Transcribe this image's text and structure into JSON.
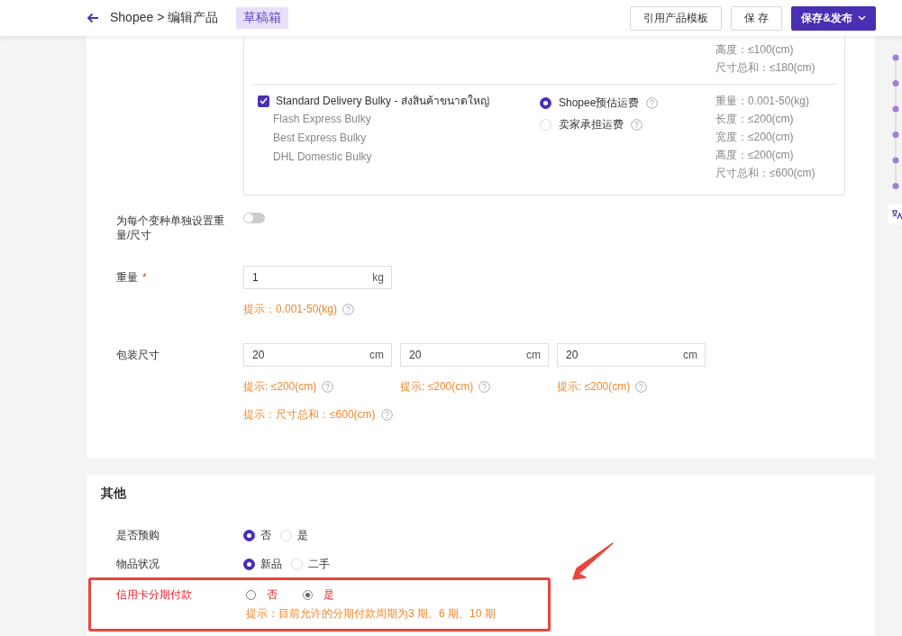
{
  "header": {
    "breadcrumb": "Shopee > 编辑产品",
    "badge": "草稿箱",
    "buttons": [
      {
        "label": "引用产品模板",
        "kind": "default"
      },
      {
        "label": "保 存",
        "kind": "default"
      },
      {
        "label": "保存&发布",
        "kind": "primary"
      }
    ]
  },
  "shipping": {
    "top_specs": [
      "高度：≤100(cm)",
      "尺寸总和：≤180(cm)"
    ],
    "channel": {
      "checked": true,
      "name": "Standard Delivery Bulky - ส่งสินค้าขนาดใหญ่",
      "carriers": [
        "Flash Express Bulky",
        "Best Express Bulky",
        "DHL Domestic Bulky"
      ],
      "fee_options": [
        {
          "label": "Shopee预估运费",
          "selected": true
        },
        {
          "label": "卖家承担运费",
          "selected": false
        }
      ],
      "specs": [
        "重量：0.001-50(kg)",
        "长度：≤200(cm)",
        "宽度：≤200(cm)",
        "高度：≤200(cm)",
        "尺寸总和：≤600(cm)"
      ]
    }
  },
  "variant_toggle": {
    "label": "为每个变种单独设置重量/尺寸",
    "on": false
  },
  "weight": {
    "label": "重量",
    "required_mark": "*",
    "value": "1",
    "unit": "kg",
    "hint": "提示：0.001-50(kg)"
  },
  "package": {
    "label": "包装尺寸",
    "fields": [
      {
        "value": "20",
        "unit": "cm",
        "hint": "提示: ≤200(cm)"
      },
      {
        "value": "20",
        "unit": "cm",
        "hint": "提示: ≤200(cm)"
      },
      {
        "value": "20",
        "unit": "cm",
        "hint": "提示: ≤200(cm)"
      }
    ],
    "total_hint": "提示：尺寸总和：≤600(cm)"
  },
  "other": {
    "title": "其他",
    "rows": [
      {
        "label": "是否预购",
        "kind": "filled",
        "highlighted": false,
        "options": [
          {
            "label": "否",
            "selected": true
          },
          {
            "label": "是",
            "selected": false
          }
        ]
      },
      {
        "label": "物品状况",
        "kind": "filled",
        "highlighted": false,
        "options": [
          {
            "label": "新品",
            "selected": true
          },
          {
            "label": "二手",
            "selected": false
          }
        ]
      },
      {
        "label": "信用卡分期付款",
        "kind": "plain",
        "highlighted": true,
        "options": [
          {
            "label": "否",
            "selected": false
          },
          {
            "label": "是",
            "selected": true
          }
        ],
        "hint": "提示：目前允许的分期付款周期为3 期、6 期、10 期"
      }
    ]
  }
}
